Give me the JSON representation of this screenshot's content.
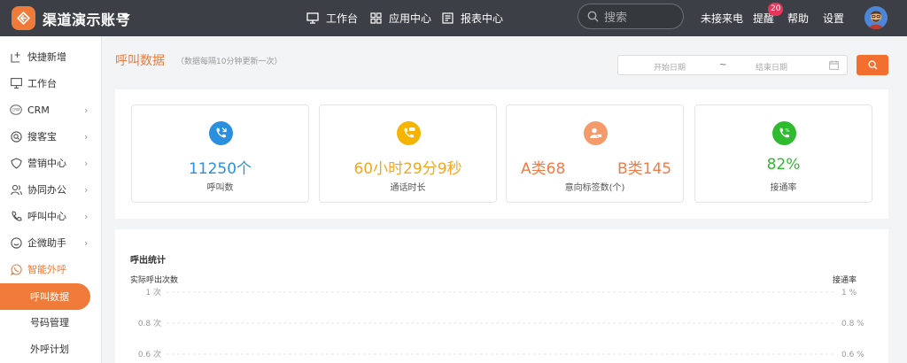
{
  "header": {
    "brand": "渠道演示账号",
    "nav": [
      {
        "label": "工作台",
        "icon": "monitor-icon"
      },
      {
        "label": "应用中心",
        "icon": "grid-icon"
      },
      {
        "label": "报表中心",
        "icon": "report-icon"
      }
    ],
    "search_placeholder": "搜索",
    "missed_calls": "未接来电",
    "reminders": "提醒",
    "reminder_badge": "20",
    "help": "帮助",
    "settings": "设置"
  },
  "sidebar": {
    "items": [
      {
        "label": "快捷新增",
        "icon": "quick-add-icon",
        "chevron": false
      },
      {
        "label": "工作台",
        "icon": "monitor-icon",
        "chevron": false
      },
      {
        "label": "CRM",
        "icon": "crm-icon",
        "chevron": true
      },
      {
        "label": "搜客宝",
        "icon": "search-customer-icon",
        "chevron": true
      },
      {
        "label": "营销中心",
        "icon": "heart-shield-icon",
        "chevron": true
      },
      {
        "label": "协同办公",
        "icon": "people-icon",
        "chevron": true
      },
      {
        "label": "呼叫中心",
        "icon": "phone-icon",
        "chevron": true
      },
      {
        "label": "企微助手",
        "icon": "smile-icon",
        "chevron": true
      },
      {
        "label": "智能外呼",
        "icon": "whatsapp-phone-icon",
        "chevron": false
      }
    ],
    "sub_items": [
      {
        "label": "呼叫数据",
        "active": true
      },
      {
        "label": "号码管理",
        "active": false
      },
      {
        "label": "外呼计划",
        "active": false
      }
    ]
  },
  "main": {
    "title": "呼叫数据",
    "subtitle": "（数据每隔10分钟更新一次）",
    "date_start_placeholder": "开始日期",
    "date_separator": "~",
    "date_end_placeholder": "结束日期",
    "stats": [
      {
        "value": "11250个",
        "label": "呼叫数",
        "color": "#2b8fe0",
        "icon": "phone-call-icon"
      },
      {
        "value": "60小时29分9秒",
        "label": "通话时长",
        "color": "#f5a623",
        "icon": "phone-timer-icon"
      },
      {
        "value_a": "A类68",
        "value_b": "B类145",
        "label": "意向标签数(个)",
        "color": "#f27c45",
        "icon": "user-tag-icon"
      },
      {
        "value": "82%",
        "label": "接通率",
        "color": "#2ebb2e",
        "icon": "phone-percent-icon"
      }
    ],
    "chart": {
      "title": "呼出统计"
    }
  },
  "chart_data": {
    "type": "line",
    "title": "呼出统计",
    "ylabel": "实际呼出次数",
    "y2label": "接通率",
    "y_ticks": [
      "1 次",
      "0.8 次",
      "0.6 次"
    ],
    "y2_ticks": [
      "1 %",
      "0.8 %",
      "0.6 %"
    ],
    "ylim": [
      0,
      1
    ],
    "grid": true,
    "series": []
  }
}
